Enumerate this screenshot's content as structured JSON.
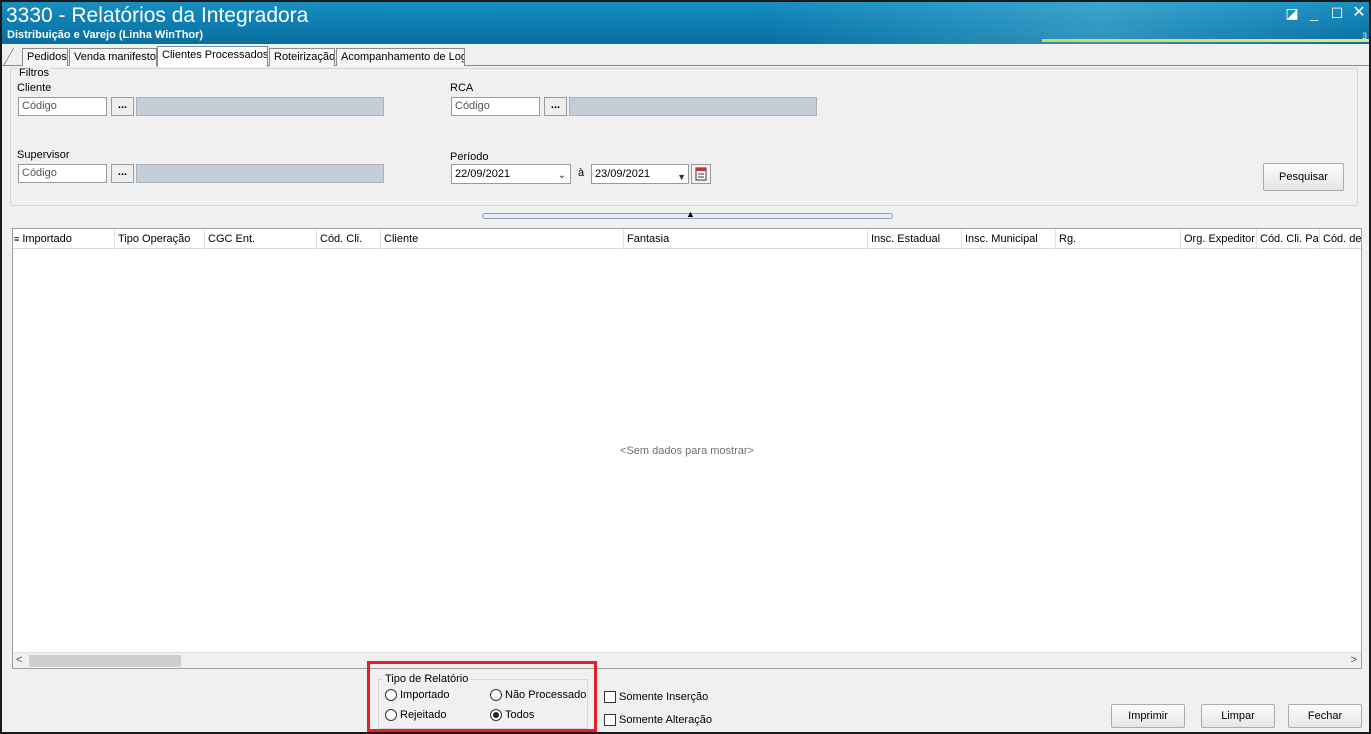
{
  "window": {
    "title": "3330 - Relatórios da Integradora",
    "subtitle": "Distribuição e Varejo (Linha WinThor)",
    "side_number": "3",
    "controls": {
      "restore": "◪",
      "minimize": "_",
      "maximize": "☐",
      "close": "✕"
    }
  },
  "tabs": [
    {
      "label": "Pedidos"
    },
    {
      "label": "Venda manifesto"
    },
    {
      "label": "Clientes Processados",
      "active": true
    },
    {
      "label": "Roteirização"
    },
    {
      "label": "Acompanhamento de Log"
    }
  ],
  "filters": {
    "legend": "Filtros",
    "cliente": {
      "label": "Cliente",
      "placeholder": "Código",
      "lookup_label": "..."
    },
    "rca": {
      "label": "RCA",
      "placeholder": "Código",
      "lookup_label": "..."
    },
    "supervisor": {
      "label": "Supervisor",
      "placeholder": "Código",
      "lookup_label": "..."
    },
    "periodo": {
      "label": "Período",
      "start": "22/09/2021",
      "separator": "à",
      "end": "23/09/2021"
    },
    "search_label": "Pesquisar"
  },
  "grid": {
    "columns": [
      "Importado",
      "Tipo Operação",
      "CGC Ent.",
      "Cód. Cli.",
      "Cliente",
      "Fantasia",
      "Insc. Estadual",
      "Insc. Municipal",
      "Rg.",
      "Org. Expeditor",
      "Cód. Cli. Pal",
      "Cód. de"
    ],
    "empty_text": "<Sem dados para mostrar>"
  },
  "report_type": {
    "legend": "Tipo de Relatório",
    "options": [
      {
        "label": "Importado",
        "selected": false
      },
      {
        "label": "Não Processado",
        "selected": false
      },
      {
        "label": "Rejeitado",
        "selected": false
      },
      {
        "label": "Todos",
        "selected": true
      }
    ]
  },
  "checkboxes": [
    {
      "label": "Somente Inserção",
      "checked": false
    },
    {
      "label": "Somente Alteração",
      "checked": false
    }
  ],
  "buttons": {
    "print": "Imprimir",
    "clear": "Limpar",
    "close": "Fechar"
  },
  "colors": {
    "titlebar": "#0f7fb3",
    "highlight": "#e0202a",
    "lookup_field": "#c4cdd6"
  }
}
